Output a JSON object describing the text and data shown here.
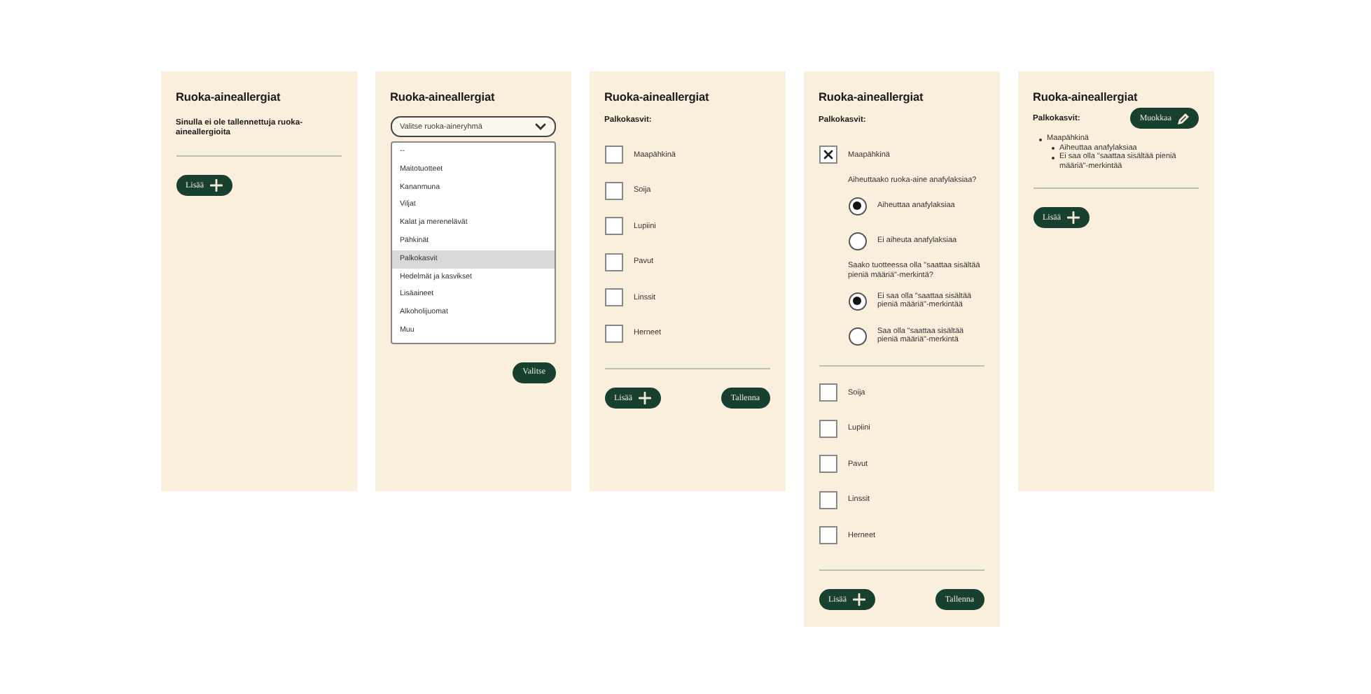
{
  "panels": [
    {
      "kind": "empty",
      "title": "Ruoka-aineallergiat",
      "message": "Sinulla ei ole tallennettuja ruoka-aineallergioita",
      "buttons": [
        {
          "label": "Lisää",
          "kind": "add"
        }
      ]
    },
    {
      "kind": "select",
      "title": "Ruoka-aineallergiat",
      "select": {
        "placeholder": "Valitse ruoka-aineryhmä"
      },
      "options": [
        {
          "label": "--",
          "selected": false
        },
        {
          "label": "Maitotuotteet",
          "selected": false
        },
        {
          "label": "Kananmuna",
          "selected": false
        },
        {
          "label": "Viljat",
          "selected": false
        },
        {
          "label": "Kalat ja merenelävät",
          "selected": false
        },
        {
          "label": "Pähkinät",
          "selected": false
        },
        {
          "label": "Palkokasvit",
          "selected": true
        },
        {
          "label": "Hedelmät ja kasvikset",
          "selected": false
        },
        {
          "label": "Lisäaineet",
          "selected": false
        },
        {
          "label": "Alkoholijuomat",
          "selected": false
        },
        {
          "label": "Muu",
          "selected": false
        }
      ],
      "buttons": [
        {
          "label": "Valitse",
          "kind": "action"
        }
      ]
    },
    {
      "kind": "checklist",
      "title": "Ruoka-aineallergiat",
      "group": "Palkokasvit:",
      "items": [
        {
          "label": "Maapähkinä",
          "checked": false
        },
        {
          "label": "Soija",
          "checked": false
        },
        {
          "label": "Lupiini",
          "checked": false
        },
        {
          "label": "Pavut",
          "checked": false
        },
        {
          "label": "Linssit",
          "checked": false
        },
        {
          "label": "Herneet",
          "checked": false
        }
      ],
      "buttons": [
        {
          "label": "Lisää",
          "kind": "add"
        },
        {
          "label": "Tallenna",
          "kind": "action"
        }
      ]
    },
    {
      "kind": "checklist",
      "title": "Ruoka-aineallergiat",
      "group": "Palkokasvit:",
      "items": [
        {
          "label": "Maapähkinä",
          "checked": true,
          "questions": [
            {
              "question": "Aiheuttaako ruoka-aine anafylaksiaa?",
              "options": [
                {
                  "label": "Aiheuttaa anafylaksiaa",
                  "selected": true
                },
                {
                  "label": "Ei aiheuta anafylaksiaa",
                  "selected": false
                }
              ]
            },
            {
              "question": "Saako tuotteessa olla \"saattaa sisältää pieniä määriä\"-merkintä?",
              "options": [
                {
                  "label": "Ei saa olla \"saattaa sisältää pieniä määriä\"-merkintää",
                  "selected": true
                },
                {
                  "label": "Saa olla \"saattaa sisältää pieniä määriä\"-merkintä",
                  "selected": false
                }
              ]
            }
          ]
        },
        {
          "label": "Soija",
          "checked": false
        },
        {
          "label": "Lupiini",
          "checked": false
        },
        {
          "label": "Pavut",
          "checked": false
        },
        {
          "label": "Linssit",
          "checked": false
        },
        {
          "label": "Herneet",
          "checked": false
        }
      ],
      "buttons": [
        {
          "label": "Lisää",
          "kind": "add"
        },
        {
          "label": "Tallenna",
          "kind": "action"
        }
      ]
    },
    {
      "kind": "summary",
      "title": "Ruoka-aineallergiat",
      "group": "Palkokasvit:",
      "edit": {
        "label": "Muokkaa",
        "kind": "edit"
      },
      "list": [
        {
          "text": "Maapähkinä",
          "children": [
            {
              "text": "Aiheuttaa anafylaksiaa"
            },
            {
              "text": "Ei saa olla \"saattaa sisältää pieniä määriä\"-merkintää"
            }
          ]
        }
      ],
      "buttons": [
        {
          "label": "Lisää",
          "kind": "add"
        }
      ]
    }
  ]
}
